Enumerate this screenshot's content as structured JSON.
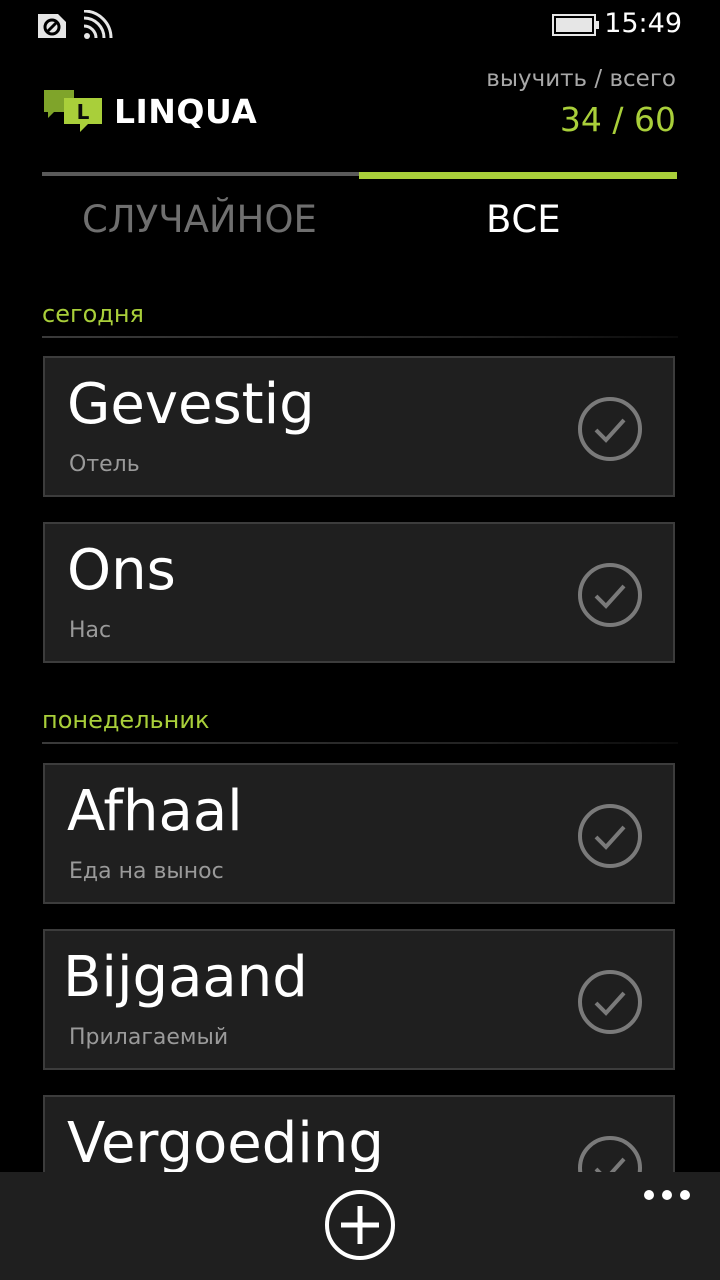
{
  "status_bar": {
    "time": "15:49",
    "icons": [
      "sync-icon",
      "wifi-icon",
      "battery-icon"
    ]
  },
  "header": {
    "app_name": "LINQUA",
    "logo_letter": "L",
    "counter_label": "выучить / всего",
    "counter_value": "34 / 60"
  },
  "tabs": [
    {
      "label": "СЛУЧАЙНОЕ",
      "selected": false
    },
    {
      "label": "ВСЕ",
      "selected": true
    }
  ],
  "sections": [
    {
      "title": "сегодня",
      "items": [
        {
          "word": "Gevestig",
          "translation": "Отель"
        },
        {
          "word": "Ons",
          "translation": "Нас"
        }
      ]
    },
    {
      "title": "понедельник",
      "items": [
        {
          "word": "Afhaal",
          "translation": "Еда на вынос"
        },
        {
          "word": "Bijgaand",
          "translation": "Прилагаемый"
        },
        {
          "word": "Vergoeding",
          "translation": ""
        }
      ]
    }
  ],
  "colors": {
    "accent": "#a9cf3a",
    "background": "#000000",
    "card": "#1f1f1f",
    "card_border": "#3c3c3c",
    "muted_text": "#9a9a9a"
  },
  "app_bar": {
    "icons": [
      "add-icon",
      "more-icon"
    ]
  }
}
